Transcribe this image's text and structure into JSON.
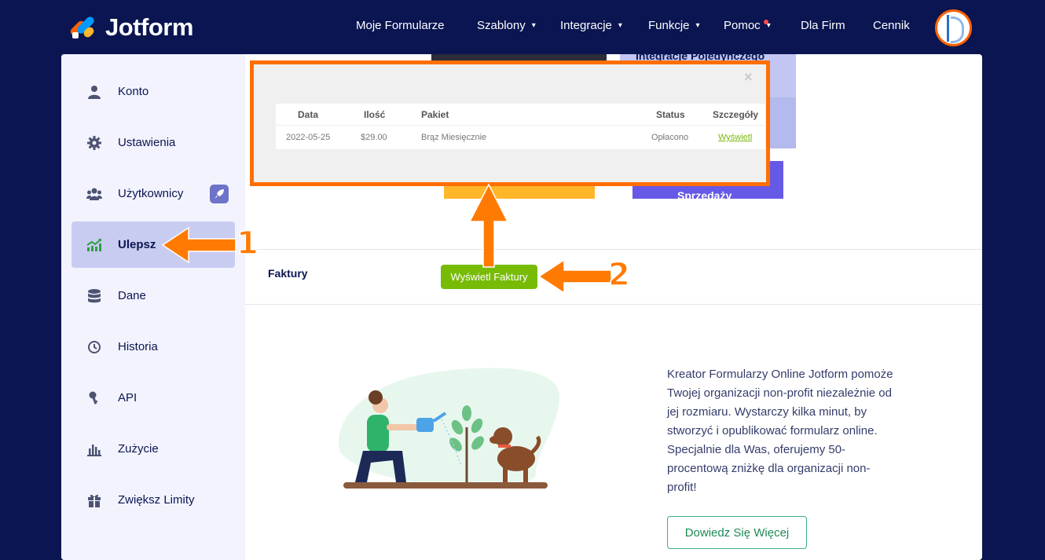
{
  "header": {
    "logo_text": "Jotform",
    "nav": [
      {
        "label": "Moje Formularze",
        "has_dropdown": false
      },
      {
        "label": "Szablony",
        "has_dropdown": true
      },
      {
        "label": "Integracje",
        "has_dropdown": true
      },
      {
        "label": "Funkcje",
        "has_dropdown": true
      },
      {
        "label": "Pomoc",
        "has_dropdown": true,
        "notification_dot": true
      },
      {
        "label": "Dla Firm",
        "has_dropdown": false
      },
      {
        "label": "Cennik",
        "has_dropdown": false
      }
    ],
    "chevron": "⌄"
  },
  "sidebar": {
    "items": [
      {
        "label": "Konto",
        "icon": "user-icon"
      },
      {
        "label": "Ustawienia",
        "icon": "gear-icon"
      },
      {
        "label": "Użytkownicy",
        "icon": "users-icon",
        "badge": "rocket-icon"
      },
      {
        "label": "Ulepsz",
        "icon": "chart-up-icon",
        "active": true
      },
      {
        "label": "Dane",
        "icon": "database-icon"
      },
      {
        "label": "Historia",
        "icon": "history-icon"
      },
      {
        "label": "API",
        "icon": "key-icon"
      },
      {
        "label": "Zużycie",
        "icon": "bar-chart-icon"
      },
      {
        "label": "Zwiększ Limity",
        "icon": "gift-icon"
      }
    ]
  },
  "background": {
    "purple_card_text": "Integracje Pojedynczego",
    "violet_button_text": "Sprzedaży"
  },
  "invoices": {
    "label": "Faktury",
    "button": "Wyświetl Faktury"
  },
  "modal": {
    "close": "×",
    "columns": [
      "Data",
      "Ilość",
      "Pakiet",
      "Status",
      "Szczegóły"
    ],
    "rows": [
      {
        "date": "2022-05-25",
        "amount": "$29.00",
        "plan": "Brąz Miesięcznie",
        "status": "Opłacono",
        "details": "Wyświetl"
      }
    ]
  },
  "promo": {
    "text": "Kreator Formularzy Online Jotform pomoże Twojej organizacji non-profit niezależnie od jej rozmiaru. Wystarczy kilka minut, by stworzyć i opublikować formularz online. Specjalnie dla Was, oferujemy 50-procentową zniżkę dla organizacji non-profit!",
    "button": "Dowiedz Się Więcej"
  },
  "annotations": {
    "step1": "1",
    "step2": "2",
    "arrow_color": "#ff7a00"
  }
}
